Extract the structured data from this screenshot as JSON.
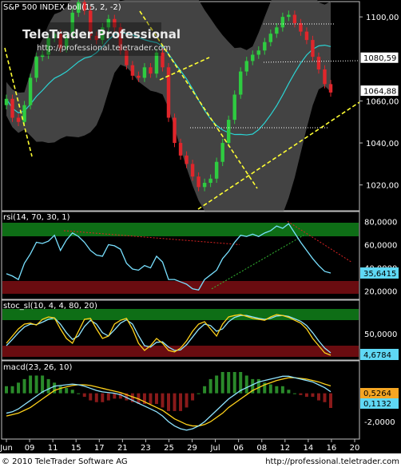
{
  "colors": {
    "background": "#000000",
    "frame": "#bfbfbf",
    "candle_up": "#2ecc40",
    "candle_down": "#e0262b",
    "band_fill": "#5a5a5a",
    "bb_mid": "#2bd3d3",
    "trend_yellow": "#ffff33",
    "rsi_line": "#78e0ff",
    "zone_green": "#0e6e16",
    "zone_red": "#6a0c10",
    "stoc_k": "#ffd21a",
    "stoc_d": "#8fe3ff",
    "macd_line": "#8fe3ff",
    "signal_line": "#ffd21a",
    "badge_orange": "#f5a623",
    "badge_cyan": "#5fd8f5",
    "footer_bg": "#ffffff"
  },
  "watermark": {
    "title": "TeleTrader Professional",
    "url": "http://professional.teletrader.com"
  },
  "footer": {
    "copyright": "© 2010 TeleTrader Software AG",
    "url": "http://professional.teletrader.com"
  },
  "chart_data": [
    {
      "type": "candlestick",
      "title": "S&P 500 INDEX boll(15, 2, -2)",
      "yticks": [
        "1100,00",
        "1080,00",
        "1060,00",
        "1040,00",
        "1020,00"
      ],
      "ylim": [
        1010,
        1105
      ],
      "badges": [
        "1080,59",
        "1064,88"
      ],
      "trend_lines": "yellow dashed support and resistance lines",
      "bollinger": {
        "period": 15,
        "k_up": 2,
        "k_down": -2
      },
      "close": [
        1061,
        1052,
        1050,
        1058,
        1071,
        1081,
        1082,
        1090,
        1092,
        1085,
        1091,
        1102,
        1107,
        1103,
        1091,
        1089,
        1095,
        1099,
        1095,
        1084,
        1077,
        1072,
        1071,
        1076,
        1073,
        1083,
        1076,
        1052,
        1040,
        1034,
        1030,
        1024,
        1019,
        1021,
        1023,
        1031,
        1040,
        1051,
        1063,
        1074,
        1079,
        1082,
        1084,
        1088,
        1092,
        1095,
        1100,
        1101,
        1097,
        1093,
        1089,
        1081,
        1075,
        1068,
        1064
      ]
    },
    {
      "type": "line",
      "title": "rsi(14, 70, 30, 1)",
      "yticks": [
        "80,0000",
        "60,0000",
        "40,0000",
        "20,0000"
      ],
      "ylim": [
        15,
        85
      ],
      "zones": {
        "upper": 70,
        "lower": 30
      },
      "badge": "35,6415",
      "values": [
        35,
        33,
        30,
        44,
        52,
        62,
        61,
        63,
        68,
        55,
        64,
        70,
        67,
        62,
        55,
        51,
        50,
        60,
        59,
        56,
        44,
        39,
        38,
        42,
        40,
        50,
        45,
        30,
        30,
        28,
        26,
        22,
        21,
        30,
        34,
        38,
        48,
        54,
        62,
        68,
        67,
        69,
        67,
        70,
        72,
        76,
        74,
        78,
        70,
        62,
        55,
        48,
        42,
        37,
        35.6
      ]
    },
    {
      "type": "line",
      "title": "stoc_sl(10, 4, 4, 80, 20)",
      "yticks": [
        "50,0000"
      ],
      "ylim": [
        0,
        100
      ],
      "zones": {
        "upper": 80,
        "lower": 20
      },
      "badge": "4,6784",
      "series": [
        {
          "values": [
            30,
            45,
            60,
            70,
            72,
            68,
            80,
            85,
            83,
            60,
            40,
            30,
            55,
            80,
            82,
            60,
            40,
            45,
            70,
            78,
            82,
            60,
            30,
            15,
            25,
            40,
            30,
            15,
            12,
            20,
            35,
            55,
            70,
            75,
            60,
            45,
            70,
            85,
            88,
            90,
            86,
            82,
            80,
            78,
            85,
            90,
            88,
            84,
            78,
            72,
            60,
            40,
            25,
            10,
            5
          ]
        },
        {
          "values": [
            25,
            38,
            52,
            64,
            70,
            69,
            74,
            80,
            83,
            70,
            52,
            38,
            45,
            65,
            78,
            70,
            52,
            45,
            58,
            72,
            79,
            70,
            46,
            25,
            22,
            32,
            33,
            22,
            15,
            16,
            27,
            43,
            59,
            70,
            67,
            55,
            60,
            75,
            84,
            88,
            88,
            85,
            82,
            80,
            82,
            87,
            88,
            86,
            81,
            76,
            67,
            52,
            35,
            20,
            10
          ]
        }
      ]
    },
    {
      "type": "line",
      "title": "macd(23, 26, 10)",
      "yticks": [
        "0,0000",
        "-2,0000"
      ],
      "ylim": [
        -3,
        1.5
      ],
      "badges": [
        "0,5264",
        "0,1132"
      ],
      "series": [
        {
          "values": [
            -1.4,
            -1.3,
            -1.1,
            -0.8,
            -0.5,
            -0.2,
            0.1,
            0.3,
            0.5,
            0.55,
            0.6,
            0.65,
            0.6,
            0.5,
            0.35,
            0.2,
            0.1,
            0.05,
            0.0,
            -0.1,
            -0.3,
            -0.5,
            -0.7,
            -0.9,
            -1.1,
            -1.3,
            -1.6,
            -2.0,
            -2.3,
            -2.5,
            -2.6,
            -2.5,
            -2.3,
            -2.0,
            -1.6,
            -1.2,
            -0.8,
            -0.4,
            -0.1,
            0.2,
            0.4,
            0.6,
            0.8,
            0.9,
            1.0,
            1.1,
            1.2,
            1.2,
            1.1,
            1.0,
            0.9,
            0.8,
            0.6,
            0.4,
            0.113
          ]
        },
        {
          "values": [
            -1.6,
            -1.5,
            -1.4,
            -1.2,
            -1.0,
            -0.7,
            -0.4,
            -0.1,
            0.2,
            0.35,
            0.45,
            0.55,
            0.6,
            0.6,
            0.55,
            0.45,
            0.35,
            0.25,
            0.15,
            0.05,
            -0.1,
            -0.25,
            -0.4,
            -0.6,
            -0.8,
            -1.0,
            -1.2,
            -1.5,
            -1.8,
            -2.0,
            -2.2,
            -2.3,
            -2.3,
            -2.2,
            -2.0,
            -1.7,
            -1.4,
            -1.0,
            -0.7,
            -0.4,
            -0.1,
            0.2,
            0.4,
            0.6,
            0.75,
            0.9,
            1.0,
            1.1,
            1.1,
            1.05,
            1.0,
            0.9,
            0.8,
            0.65,
            0.526
          ]
        }
      ]
    }
  ],
  "x_axis": {
    "labels": [
      "Jun",
      "09",
      "11",
      "15",
      "17",
      "21",
      "23",
      "25",
      "29",
      "Jul",
      "06",
      "08",
      "12",
      "14",
      "16",
      "20"
    ]
  }
}
